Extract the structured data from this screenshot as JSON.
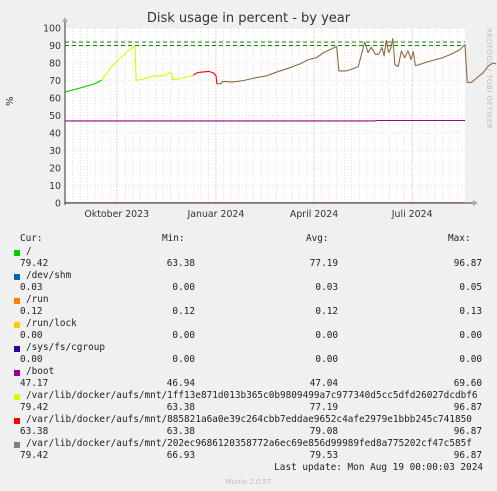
{
  "chart_data": {
    "type": "line",
    "title": "Disk usage in percent - by year",
    "side_label": "RRDTOOL / TOBI OETIKER",
    "ylabel": "%",
    "ylim": [
      0,
      100
    ],
    "yticks": [
      0,
      10,
      20,
      30,
      40,
      50,
      60,
      70,
      80,
      90,
      100
    ],
    "x_tick_labels": [
      "Oktober 2023",
      "Januar 2024",
      "April 2024",
      "Juli 2024"
    ],
    "x_tick_dates": [
      "2023-10-01",
      "2024-01-01",
      "2024-04-01",
      "2024-07-01"
    ],
    "x_range": [
      "2023-08-14",
      "2024-08-19"
    ],
    "grid": true,
    "warning_levels": [
      90,
      92
    ],
    "colors": {
      "background": "#f0f0f0",
      "plot_background": "#ffffff",
      "grid_minor": "#e8bcbc",
      "grid_major": "#e8bcbc",
      "warning": "#008800",
      "axis": "#333333"
    },
    "series": [
      {
        "name": "/",
        "color": "#00cc00",
        "points": [
          [
            "2023-08-14",
            63.4
          ],
          [
            "2023-08-20",
            64.4
          ],
          [
            "2023-08-31",
            66.2
          ],
          [
            "2023-09-10",
            68.0
          ],
          [
            "2023-09-17",
            70.1
          ]
        ]
      },
      {
        "name": "/dev/shm",
        "color": "#0066b3",
        "points": [
          [
            "2023-08-14",
            0.03
          ],
          [
            "2024-08-19",
            0.03
          ]
        ]
      },
      {
        "name": "/run",
        "color": "#ff8000",
        "points": [
          [
            "2023-08-14",
            0.12
          ],
          [
            "2024-08-19",
            0.12
          ]
        ]
      },
      {
        "name": "/run/lock",
        "color": "#ffcc00",
        "points": [
          [
            "2023-08-14",
            0.0
          ],
          [
            "2024-08-19",
            0.0
          ]
        ]
      },
      {
        "name": "/sys/fs/cgroup",
        "color": "#330099",
        "points": [
          [
            "2023-08-14",
            0.0
          ],
          [
            "2024-08-19",
            0.0
          ]
        ]
      },
      {
        "name": "/boot",
        "color": "#990099",
        "points": [
          [
            "2023-08-14",
            46.94
          ],
          [
            "2024-05-28",
            46.94
          ],
          [
            "2024-05-29",
            47.17
          ],
          [
            "2024-08-19",
            47.17
          ]
        ]
      },
      {
        "name": "/var/lib/docker/aufs/mnt/1ff13e871d013b365c0b9809499a7c977340d5cc5dfd26027dcdbf6",
        "color": "#ccff00",
        "points": [
          [
            "2023-09-17",
            70.1
          ],
          [
            "2023-09-25",
            77.0
          ],
          [
            "2023-10-03",
            82.0
          ],
          [
            "2023-10-10",
            86.0
          ],
          [
            "2023-10-16",
            89.0
          ],
          [
            "2023-10-18",
            89.5
          ],
          [
            "2023-10-19",
            70.0
          ],
          [
            "2023-10-26",
            71.0
          ],
          [
            "2023-11-03",
            72.5
          ],
          [
            "2023-11-14",
            72.8
          ],
          [
            "2023-11-19",
            74.5
          ],
          [
            "2023-11-21",
            74.0
          ],
          [
            "2023-11-22",
            70.5
          ],
          [
            "2023-11-27",
            71.0
          ],
          [
            "2023-12-05",
            72.0
          ],
          [
            "2023-12-11",
            73.0
          ]
        ]
      },
      {
        "name": "/var/lib/docker/aufs/mnt/885821a6a0e39c264cbb7eddae9652c4afe2979e1bbb245c741850",
        "color": "#ff0000",
        "points": [
          [
            "2023-12-11",
            73.0
          ],
          [
            "2023-12-15",
            74.5
          ],
          [
            "2023-12-25",
            75.2
          ],
          [
            "2023-12-29",
            74.5
          ],
          [
            "2024-01-01",
            73.0
          ],
          [
            "2024-01-02",
            68.0
          ]
        ]
      },
      {
        "name": "/var/lib/docker/aufs/mnt/202ec9686120358772a6ec69e856d99989fed8a775202cf47c585f",
        "color": "#808080",
        "line_color": "#8a6a44",
        "points": [
          [
            "2024-01-02",
            68.0
          ],
          [
            "2024-01-06",
            68.2
          ],
          [
            "2024-01-07",
            69.5
          ],
          [
            "2024-01-17",
            69.2
          ],
          [
            "2024-01-27",
            70.0
          ],
          [
            "2024-02-06",
            71.5
          ],
          [
            "2024-02-16",
            72.5
          ],
          [
            "2024-02-27",
            75.0
          ],
          [
            "2024-03-08",
            77.0
          ],
          [
            "2024-03-19",
            79.5
          ],
          [
            "2024-03-27",
            82.0
          ],
          [
            "2024-04-03",
            83.0
          ],
          [
            "2024-04-10",
            86.0
          ],
          [
            "2024-04-17",
            88.0
          ],
          [
            "2024-04-22",
            89.5
          ],
          [
            "2024-04-24",
            75.5
          ],
          [
            "2024-05-01",
            75.5
          ],
          [
            "2024-05-06",
            76.5
          ],
          [
            "2024-05-12",
            78.0
          ],
          [
            "2024-05-18",
            92.0
          ],
          [
            "2024-05-21",
            86.0
          ],
          [
            "2024-05-24",
            89.0
          ],
          [
            "2024-05-28",
            85.0
          ],
          [
            "2024-05-31",
            85.0
          ],
          [
            "2024-06-03",
            89.0
          ],
          [
            "2024-06-05",
            84.0
          ],
          [
            "2024-06-07",
            93.0
          ],
          [
            "2024-06-09",
            86.0
          ],
          [
            "2024-06-11",
            88.0
          ],
          [
            "2024-06-13",
            94.0
          ],
          [
            "2024-06-15",
            79.0
          ],
          [
            "2024-06-18",
            78.0
          ],
          [
            "2024-06-21",
            87.0
          ],
          [
            "2024-06-24",
            83.0
          ],
          [
            "2024-06-27",
            87.0
          ],
          [
            "2024-06-30",
            82.0
          ],
          [
            "2024-07-02",
            86.5
          ],
          [
            "2024-07-04",
            78.5
          ],
          [
            "2024-07-07",
            79.0
          ],
          [
            "2024-07-12",
            80.0
          ],
          [
            "2024-07-20",
            81.5
          ],
          [
            "2024-07-29",
            83.0
          ],
          [
            "2024-08-06",
            85.0
          ],
          [
            "2024-08-14",
            87.5
          ],
          [
            "2024-08-19",
            90.5
          ],
          [
            "2024-08-21",
            69.0
          ],
          [
            "2024-08-25",
            69.0
          ],
          [
            "2024-08-31",
            72.0
          ],
          [
            "2024-09-05",
            74.5
          ],
          [
            "2024-09-10",
            78.5
          ],
          [
            "2024-09-14",
            80.0
          ],
          [
            "2024-09-17",
            79.5
          ]
        ]
      }
    ]
  },
  "legend": {
    "headers": {
      "cur": "Cur:",
      "min": "Min:",
      "avg": "Avg:",
      "max": "Max:"
    },
    "rows": [
      {
        "name": "/",
        "color": "#00cc00",
        "cur": "79.42",
        "min": "63.38",
        "avg": "77.19",
        "max": "96.87"
      },
      {
        "name": "/dev/shm",
        "color": "#0066b3",
        "cur": "0.03",
        "min": "0.00",
        "avg": "0.03",
        "max": "0.05"
      },
      {
        "name": "/run",
        "color": "#ff8000",
        "cur": "0.12",
        "min": "0.12",
        "avg": "0.12",
        "max": "0.13"
      },
      {
        "name": "/run/lock",
        "color": "#ffcc00",
        "cur": "0.00",
        "min": "0.00",
        "avg": "0.00",
        "max": "0.00"
      },
      {
        "name": "/sys/fs/cgroup",
        "color": "#330099",
        "cur": "0.00",
        "min": "0.00",
        "avg": "0.00",
        "max": "0.00"
      },
      {
        "name": "/boot",
        "color": "#990099",
        "cur": "47.17",
        "min": "46.94",
        "avg": "47.04",
        "max": "69.60"
      },
      {
        "name": "/var/lib/docker/aufs/mnt/1ff13e871d013b365c0b9809499a7c977340d5cc5dfd26027dcdbf6",
        "color": "#ccff00",
        "cur": "79.42",
        "min": "63.38",
        "avg": "77.19",
        "max": "96.87"
      },
      {
        "name": "/var/lib/docker/aufs/mnt/885821a6a0e39c264cbb7eddae9652c4afe2979e1bbb245c741850",
        "color": "#ff0000",
        "cur": "63.38",
        "min": "63.38",
        "avg": "79.08",
        "max": "96.87"
      },
      {
        "name": "/var/lib/docker/aufs/mnt/202ec9686120358772a6ec69e856d99989fed8a775202cf47c585f",
        "color": "#808080",
        "cur": "79.42",
        "min": "66.93",
        "avg": "79.53",
        "max": "96.87"
      }
    ]
  },
  "footer": {
    "last_update": "Last update: Mon Aug 19 00:00:03 2024",
    "version": "Munin 2.0.57"
  }
}
